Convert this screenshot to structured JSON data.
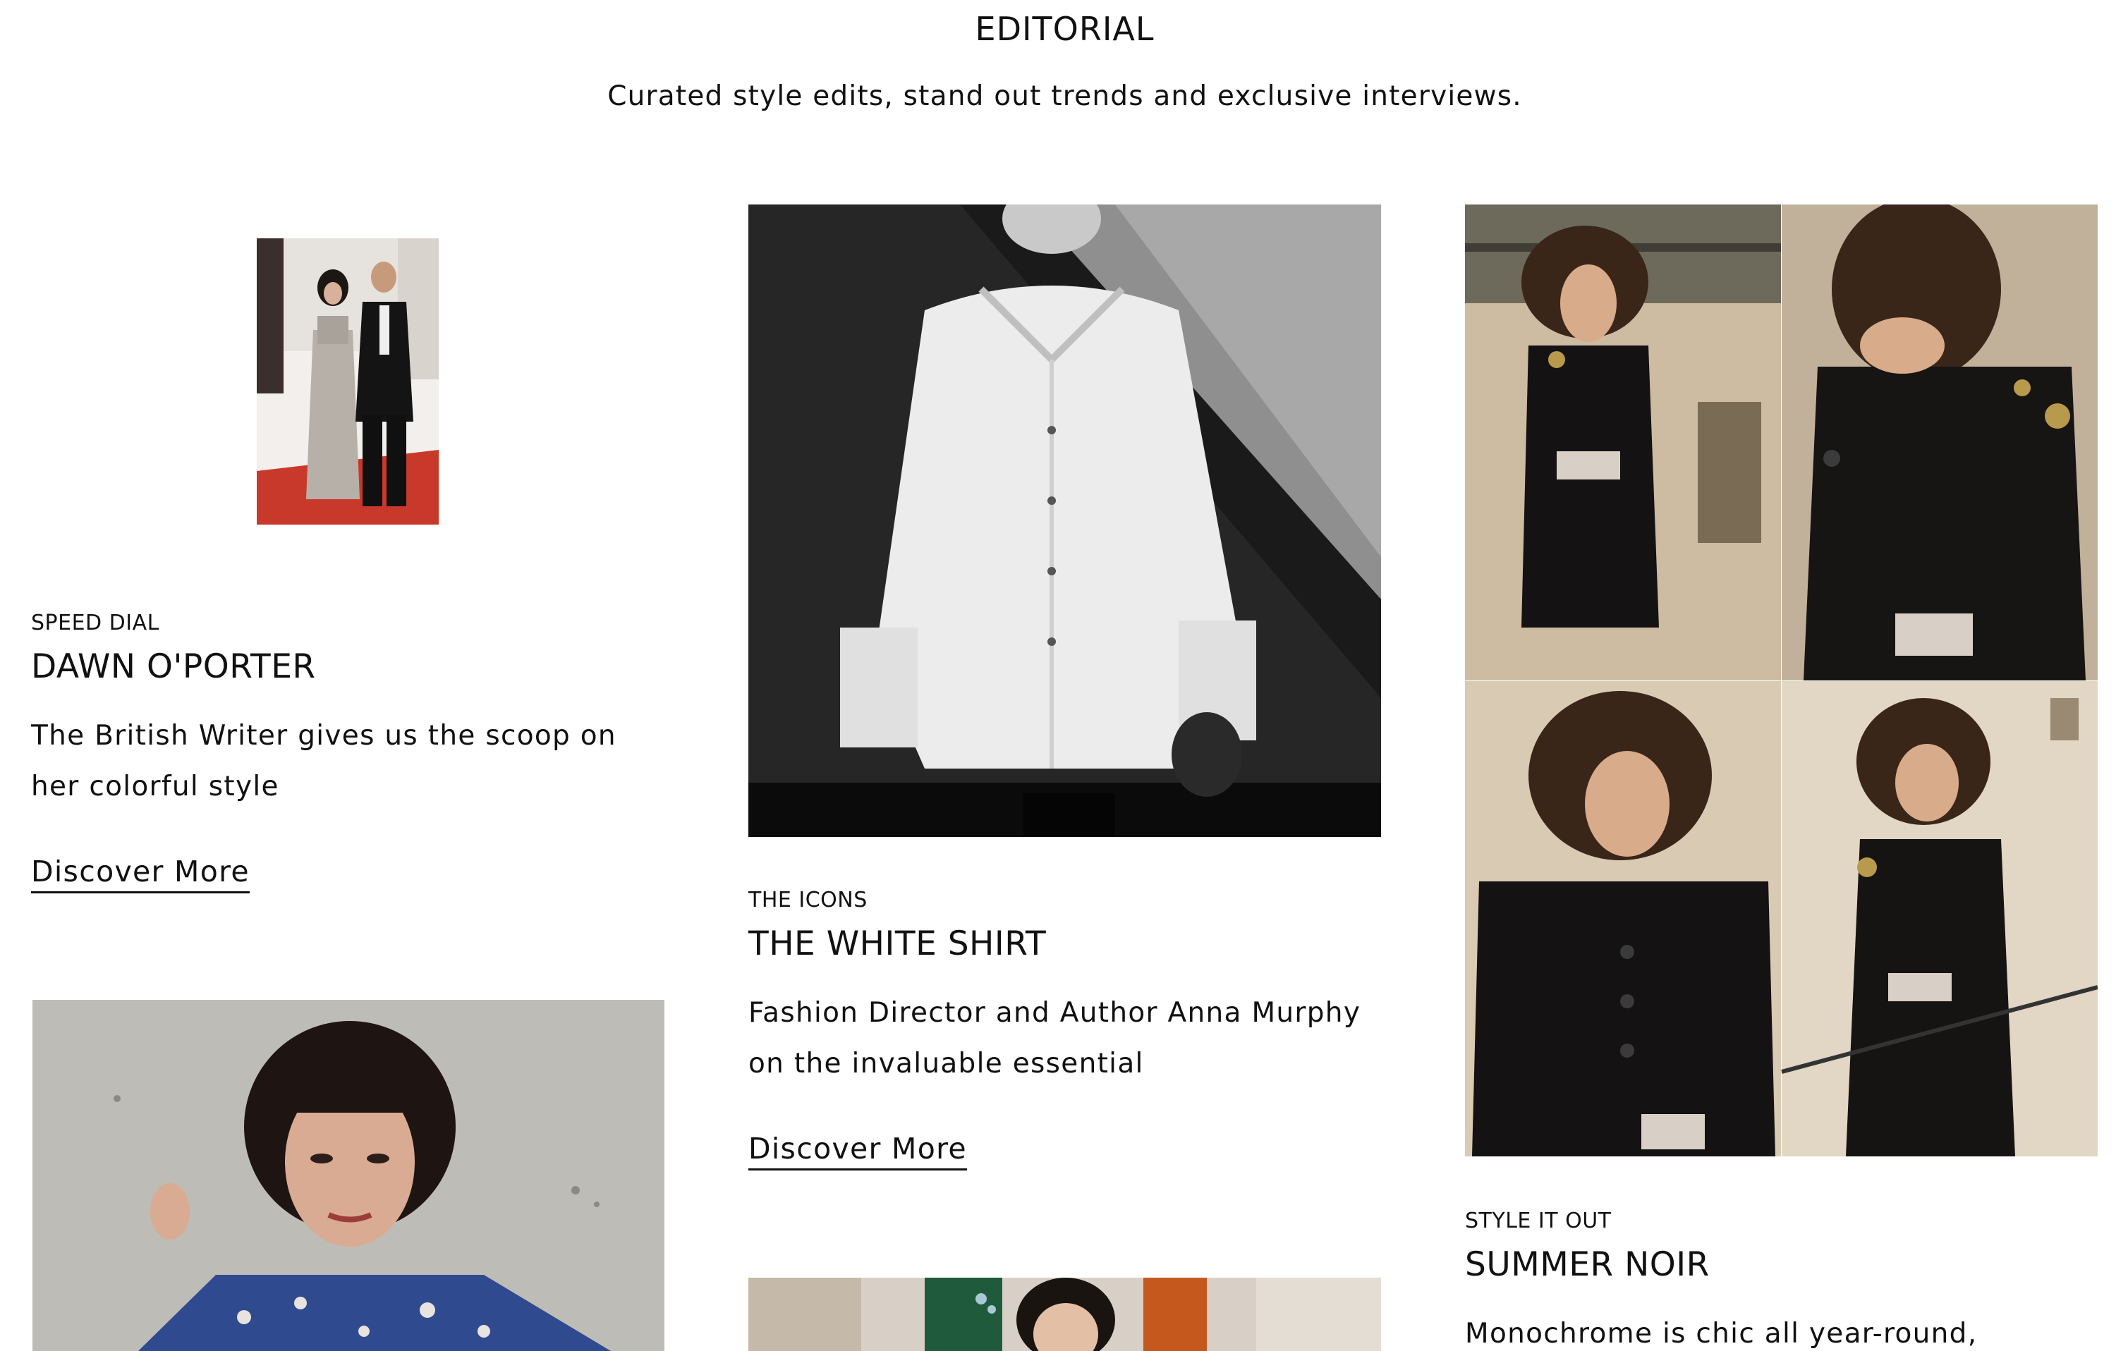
{
  "header": {
    "title": "EDITORIAL",
    "subtitle": "Curated style edits, stand out trends and exclusive interviews."
  },
  "articles": [
    {
      "kicker": "SPEED DIAL",
      "title": "DAWN O'PORTER",
      "blurb": "The British Writer gives us the scoop on her colorful style",
      "cta": "Discover More"
    },
    {
      "kicker": "THE ICONS",
      "title": "THE WHITE SHIRT",
      "blurb": "Fashion Director and Author Anna Murphy on the invaluable essential",
      "cta": "Discover More"
    },
    {
      "kicker": "STYLE IT OUT",
      "title": "SUMMER NOIR",
      "blurb": "Monochrome is chic all year-round,"
    }
  ],
  "colors": {
    "text": "#111111",
    "background": "#ffffff",
    "red_carpet": "#c8392b"
  }
}
